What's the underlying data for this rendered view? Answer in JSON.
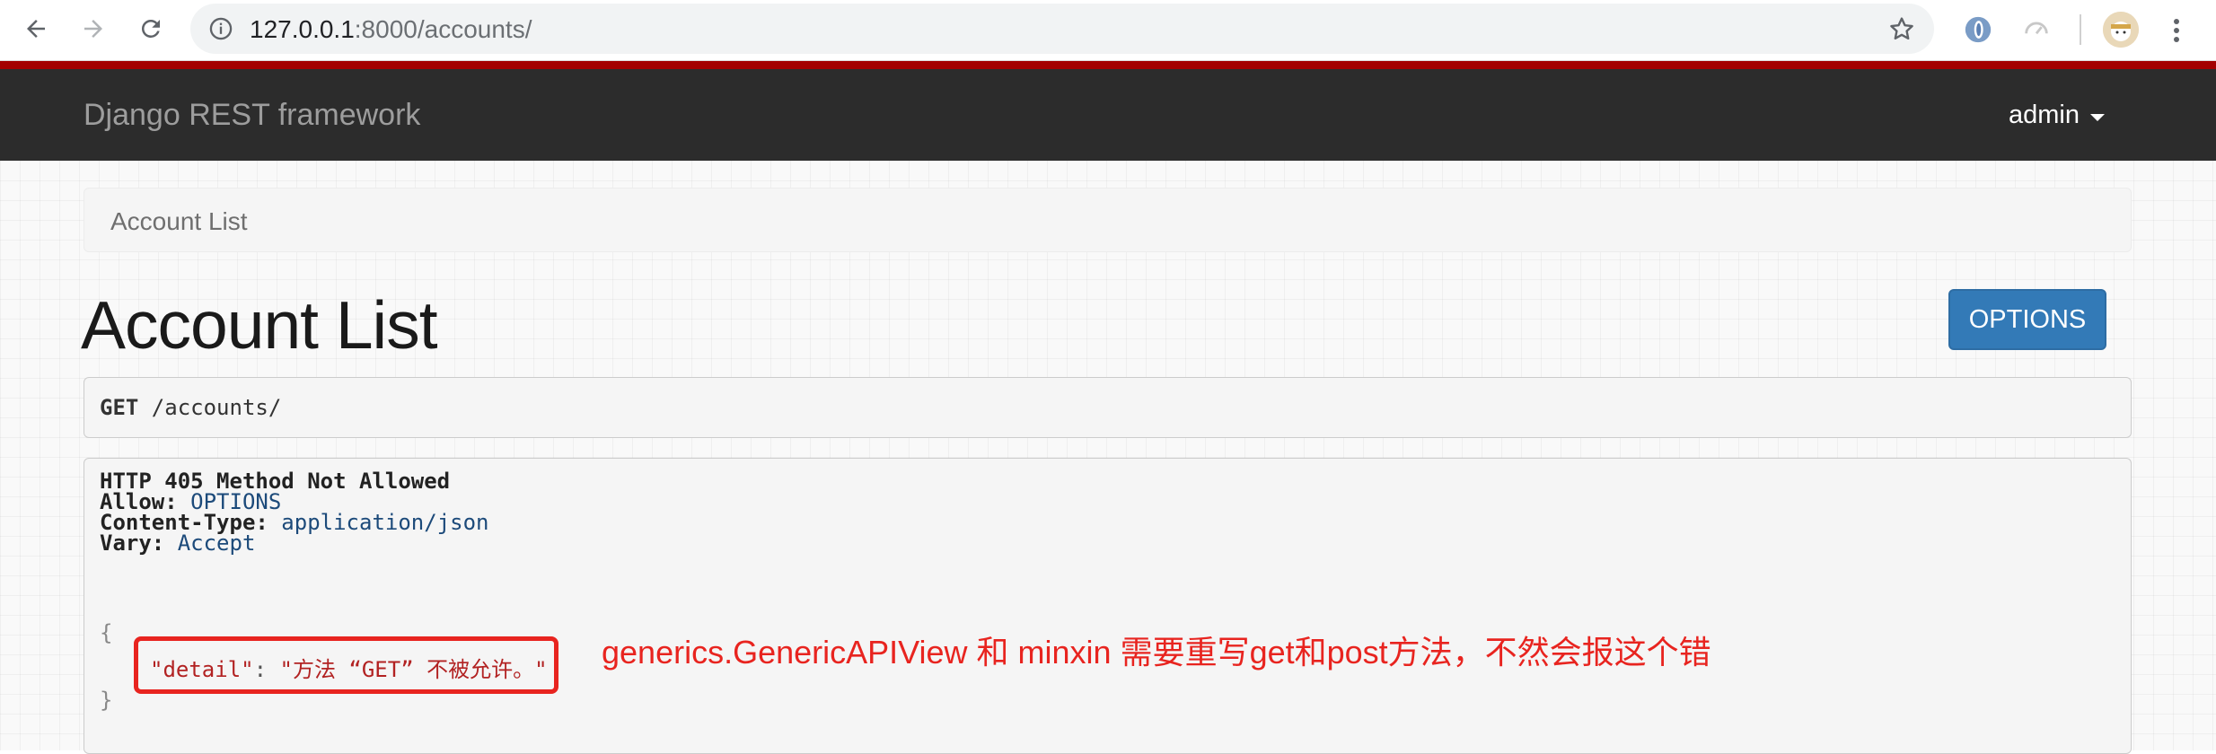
{
  "browser": {
    "url_host": "127.0.0.1",
    "url_rest": ":8000/accounts/",
    "icons": [
      "back-arrow-icon",
      "forward-arrow-icon",
      "reload-icon",
      "info-icon",
      "star-icon",
      "extension-icon",
      "extension-icon",
      "avatar",
      "menu-dots-icon"
    ]
  },
  "navbar": {
    "brand": "Django REST framework",
    "user": "admin",
    "accent_color": "#a30000"
  },
  "breadcrumb": {
    "item": "Account List"
  },
  "page": {
    "title": "Account List",
    "options_label": "OPTIONS"
  },
  "request": {
    "method": "GET",
    "path": " /accounts/"
  },
  "response": {
    "status": "HTTP 405 Method Not Allowed",
    "headers": [
      {
        "name": "Allow:",
        "value": "OPTIONS"
      },
      {
        "name": "Content-Type:",
        "value": "application/json"
      },
      {
        "name": "Vary:",
        "value": "Accept"
      }
    ],
    "open_brace": "{",
    "json_key": "\"detail\"",
    "json_colon": ": ",
    "json_value": "\"方法 “GET” 不被允许。\"",
    "close_brace": "}"
  },
  "annotation": {
    "text": "generics.GenericAPIView 和 minxin 需要重写get和post方法，不然会报这个错",
    "color": "#e8241f"
  }
}
